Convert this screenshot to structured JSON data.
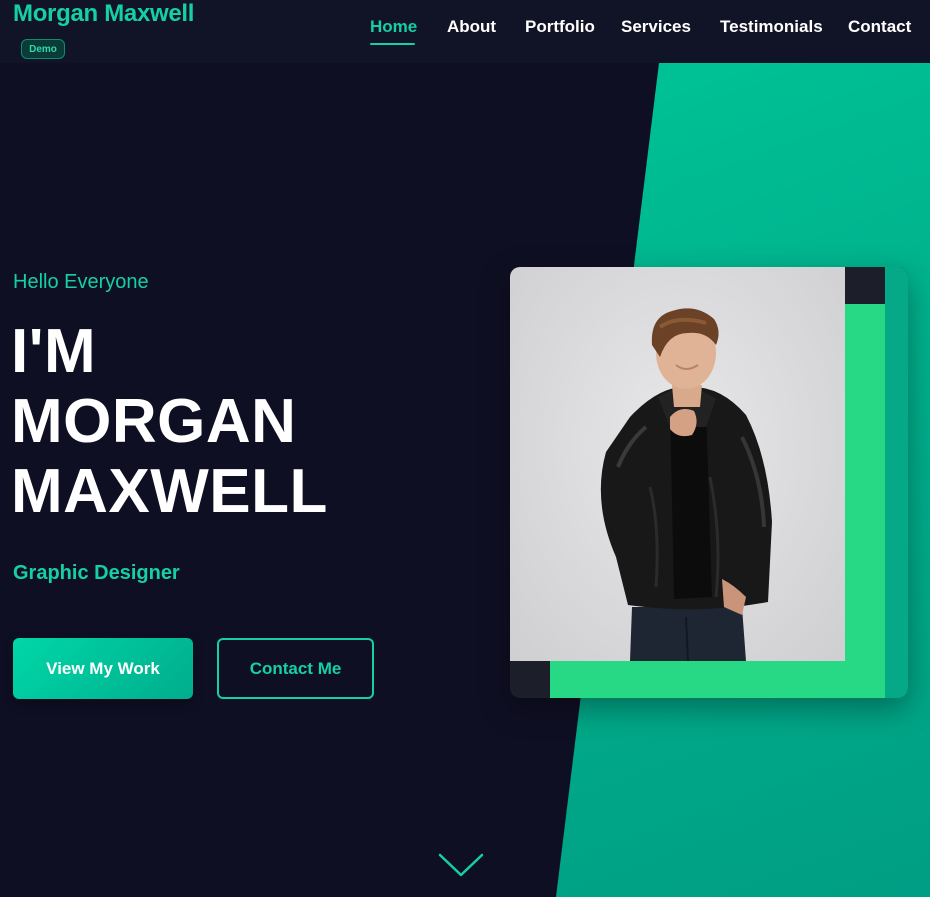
{
  "brand": {
    "name": "Morgan Maxwell",
    "badge": "Demo"
  },
  "nav": {
    "items": [
      {
        "label": "Home",
        "active": true
      },
      {
        "label": "About",
        "active": false
      },
      {
        "label": "Portfolio",
        "active": false
      },
      {
        "label": "Services",
        "active": false
      },
      {
        "label": "Testimonials",
        "active": false
      },
      {
        "label": "Contact",
        "active": false
      }
    ]
  },
  "hero": {
    "greeting": "Hello Everyone",
    "headline_lines": [
      "I'M",
      "MORGAN",
      "MAXWELL"
    ],
    "role": "Graphic Designer",
    "primary_button": "View My Work",
    "secondary_button": "Contact Me"
  },
  "colors": {
    "background": "#0f0f23",
    "accent": "#14d0a2",
    "panel_green": "#00b08c",
    "frame_green": "#27d885"
  },
  "icons": {
    "scroll": "chevron-down-icon"
  }
}
